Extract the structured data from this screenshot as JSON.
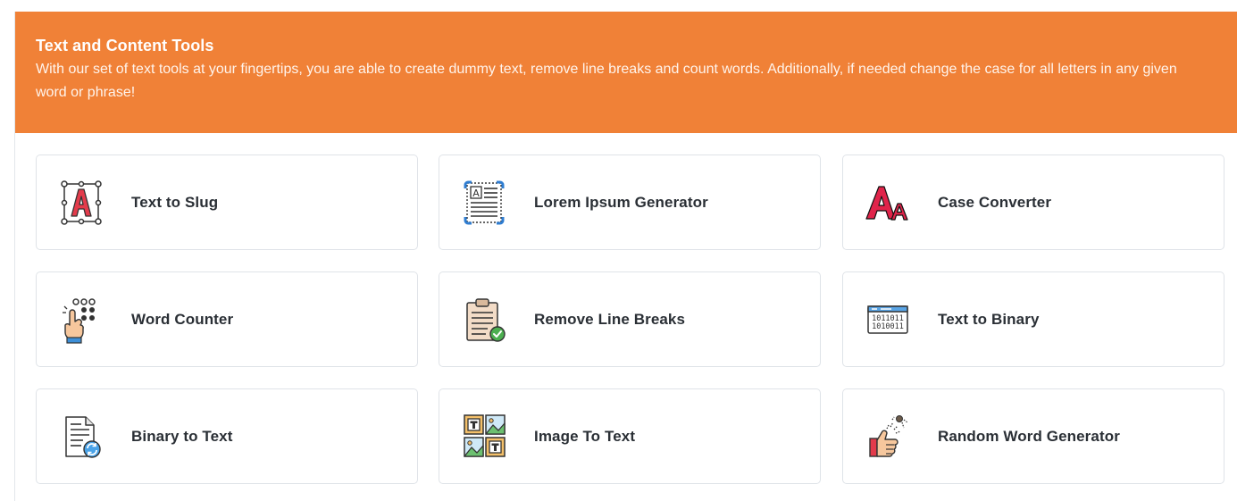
{
  "section": {
    "title": "Text and Content Tools",
    "description": "With our set of text tools at your fingertips, you are able to create dummy text, remove line breaks and count words. Additionally, if needed change the case for all letters in any given word or phrase!"
  },
  "colors": {
    "banner": "#f08137",
    "card_border": "#dfe3e8",
    "label_text": "#2a2f35"
  },
  "tools": [
    {
      "label": "Text to Slug",
      "icon": "text-slug-icon"
    },
    {
      "label": "Lorem Ipsum Generator",
      "icon": "lorem-ipsum-icon"
    },
    {
      "label": "Case Converter",
      "icon": "case-converter-icon"
    },
    {
      "label": "Word Counter",
      "icon": "word-counter-icon"
    },
    {
      "label": "Remove Line Breaks",
      "icon": "remove-line-breaks-icon"
    },
    {
      "label": "Text to Binary",
      "icon": "text-to-binary-icon"
    },
    {
      "label": "Binary to Text",
      "icon": "binary-to-text-icon"
    },
    {
      "label": "Image To Text",
      "icon": "image-to-text-icon"
    },
    {
      "label": "Random Word Generator",
      "icon": "random-word-icon"
    }
  ]
}
